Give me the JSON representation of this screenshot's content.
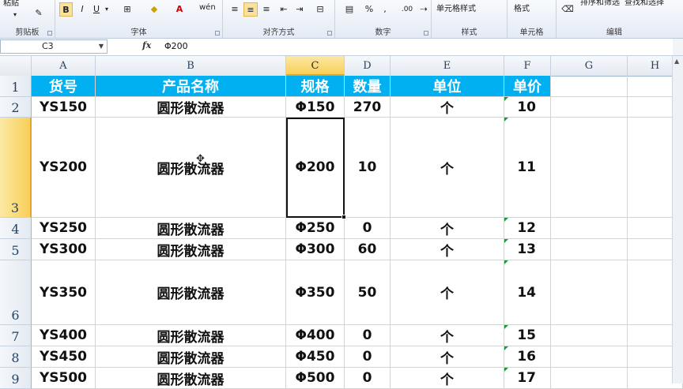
{
  "ribbon": {
    "groups": [
      {
        "label": "剪贴板"
      },
      {
        "label": "字体"
      },
      {
        "label": "对齐方式"
      },
      {
        "label": "数字"
      },
      {
        "label": "样式"
      },
      {
        "label": "单元格"
      },
      {
        "label": "编辑"
      }
    ],
    "paste_label": "粘贴",
    "bold": "B",
    "italic": "I",
    "underline": "U",
    "percent": "%",
    "comma": ",",
    "inc_decimal": ".00",
    "cell_style_label": "单元格样式",
    "format_label": "格式",
    "sort_filter_label": "排序和筛选",
    "find_select_label": "查找和选择",
    "wen": "wén"
  },
  "formula_bar": {
    "name_box": "C3",
    "fx": "fx",
    "value": "Φ200"
  },
  "columns": [
    "A",
    "B",
    "C",
    "D",
    "E",
    "F",
    "G",
    "H"
  ],
  "active_column": "C",
  "active_row": "3",
  "rows": [
    {
      "num": "1",
      "cells": [
        "货号",
        "产品名称",
        "规格",
        "数量",
        "单位",
        "单价"
      ]
    },
    {
      "num": "2",
      "cells": [
        "YS150",
        "圆形散流器",
        "Φ150",
        "270",
        "个",
        "10"
      ]
    },
    {
      "num": "3",
      "cells": [
        "YS200",
        "圆形散流器",
        "Φ200",
        "10",
        "个",
        "11"
      ]
    },
    {
      "num": "4",
      "cells": [
        "YS250",
        "圆形散流器",
        "Φ250",
        "0",
        "个",
        "12"
      ]
    },
    {
      "num": "5",
      "cells": [
        "YS300",
        "圆形散流器",
        "Φ300",
        "60",
        "个",
        "13"
      ]
    },
    {
      "num": "6",
      "cells": [
        "YS350",
        "圆形散流器",
        "Φ350",
        "50",
        "个",
        "14"
      ]
    },
    {
      "num": "7",
      "cells": [
        "YS400",
        "圆形散流器",
        "Φ400",
        "0",
        "个",
        "15"
      ]
    },
    {
      "num": "8",
      "cells": [
        "YS450",
        "圆形散流器",
        "Φ450",
        "0",
        "个",
        "16"
      ]
    },
    {
      "num": "9",
      "cells": [
        "YS500",
        "圆形散流器",
        "Φ500",
        "0",
        "个",
        "17"
      ]
    }
  ],
  "colors": {
    "header_fill": "#00b0f0",
    "header_text": "#ffffff",
    "selection_accent": "#f8cf57"
  }
}
